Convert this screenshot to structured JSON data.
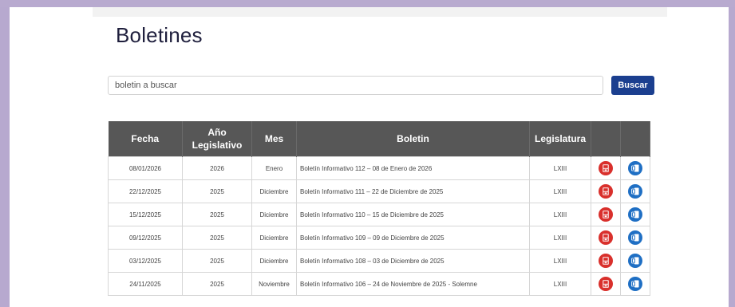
{
  "page": {
    "title": "Boletines"
  },
  "search": {
    "placeholder": "boletin a buscar",
    "button_label": "Buscar"
  },
  "table": {
    "headers": {
      "fecha": "Fecha",
      "anio_line1": "Año",
      "anio_line2": "Legislativo",
      "mes": "Mes",
      "boletin": "Boletin",
      "legislatura": "Legislatura"
    },
    "rows": [
      {
        "fecha": "08/01/2026",
        "anio": "2026",
        "mes": "Enero",
        "boletin": "Boletín Informativo 112 – 08 de Enero de 2026",
        "legislatura": "LXIII"
      },
      {
        "fecha": "22/12/2025",
        "anio": "2025",
        "mes": "Diciembre",
        "boletin": "Boletín Informativo 111 – 22 de Diciembre de 2025",
        "legislatura": "LXIII"
      },
      {
        "fecha": "15/12/2025",
        "anio": "2025",
        "mes": "Diciembre",
        "boletin": "Boletín Informativo 110 – 15 de Diciembre de 2025",
        "legislatura": "LXIII"
      },
      {
        "fecha": "09/12/2025",
        "anio": "2025",
        "mes": "Diciembre",
        "boletin": "Boletín Informativo 109 – 09 de Diciembre de 2025",
        "legislatura": "LXIII"
      },
      {
        "fecha": "03/12/2025",
        "anio": "2025",
        "mes": "Diciembre",
        "boletin": "Boletín Informativo 108 – 03 de Diciembre de 2025",
        "legislatura": "LXIII"
      },
      {
        "fecha": "24/11/2025",
        "anio": "2025",
        "mes": "Noviembre",
        "boletin": "Boletín Informativo 106 – 24 de Noviembre de 2025 - Solemne",
        "legislatura": "LXIII"
      }
    ]
  },
  "icons": {
    "pdf": "pdf-document-icon",
    "word": "word-document-icon"
  },
  "colors": {
    "header_bg": "#575757",
    "button_bg": "#1b3f8f",
    "pdf_red": "#d9302c",
    "word_blue": "#1f6fc4",
    "page_border": "#b7a9cf"
  }
}
